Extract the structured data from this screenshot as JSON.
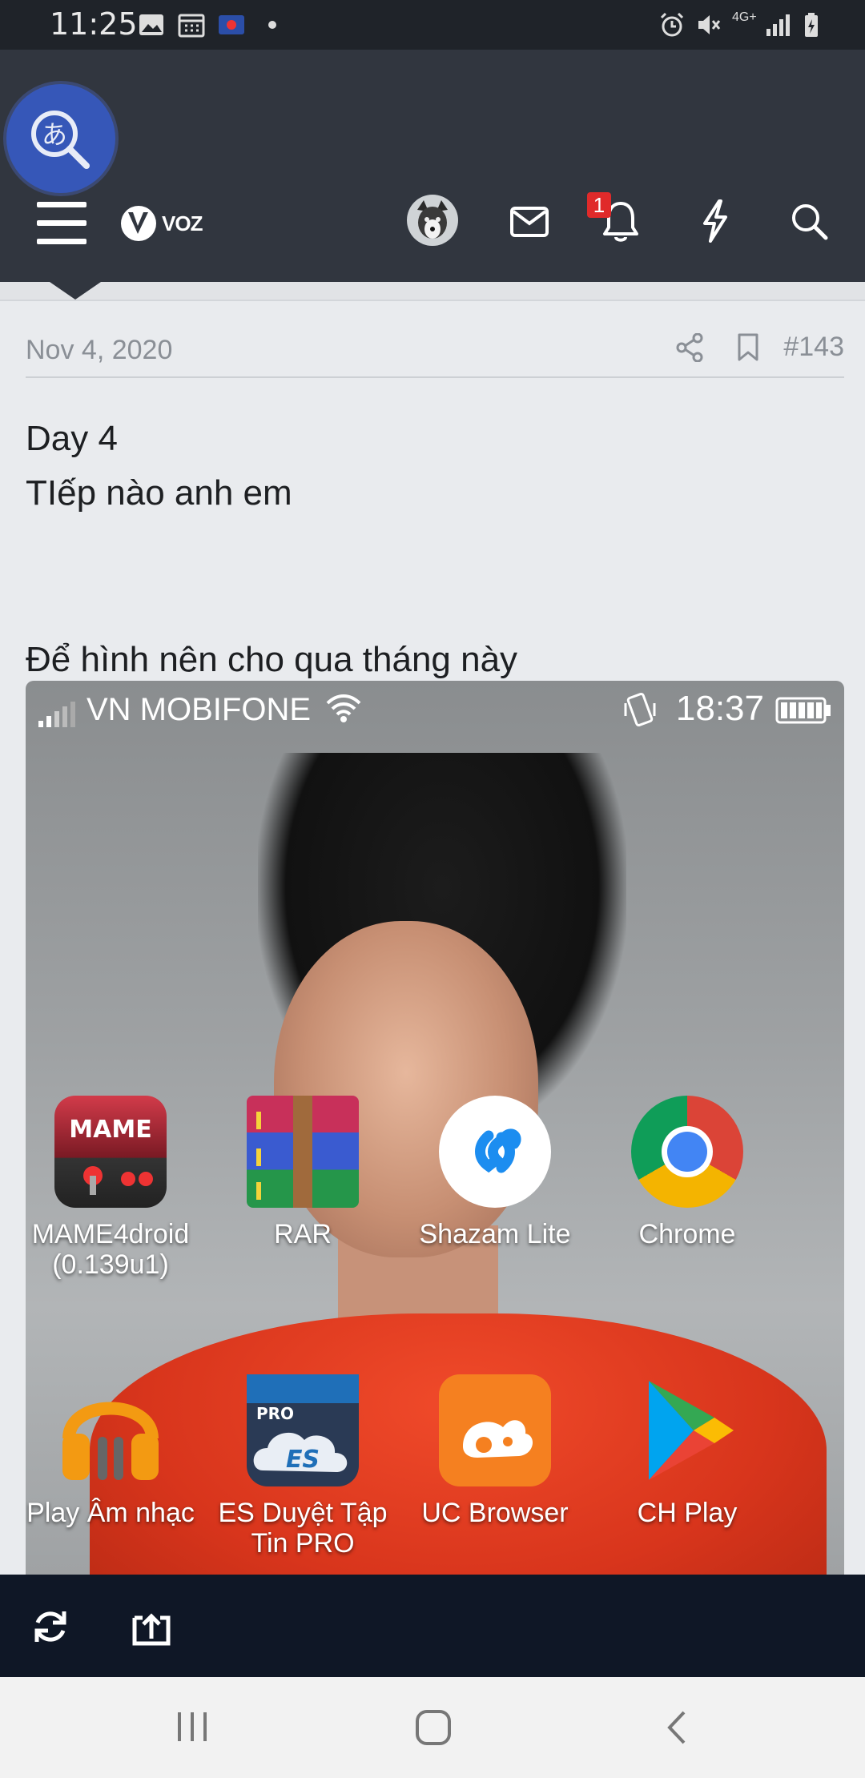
{
  "status_bar": {
    "time": "11:25",
    "network": "4G+"
  },
  "forum": {
    "logo_text": "VOZ",
    "notification_count": "1"
  },
  "post": {
    "date": "Nov 4, 2020",
    "number": "#143",
    "lines": [
      "Day 4",
      "TIếp nào anh em",
      "Để hình nên cho qua tháng này"
    ]
  },
  "embedded_screenshot": {
    "carrier": "VN MOBIFONE",
    "time": "18:37",
    "apps": [
      {
        "label": "MAME4droid\n(0.139u1)",
        "icon": "mame4droid-icon"
      },
      {
        "label": "RAR",
        "icon": "rar-icon"
      },
      {
        "label": "Shazam Lite",
        "icon": "shazam-icon"
      },
      {
        "label": "Chrome",
        "icon": "chrome-icon"
      },
      {
        "label": "Play Âm nhạc",
        "icon": "play-music-icon"
      },
      {
        "label": "ES Duyệt Tập\nTin PRO",
        "icon": "es-file-explorer-icon"
      },
      {
        "label": "UC Browser",
        "icon": "uc-browser-icon"
      },
      {
        "label": "CH Play",
        "icon": "play-store-icon"
      }
    ]
  },
  "colors": {
    "header_bg": "#31363f",
    "status_bg": "#1f2329",
    "badge": "#e02a2a",
    "translate_bubble": "#3657b8",
    "bottom_bar": "#0f1726"
  }
}
